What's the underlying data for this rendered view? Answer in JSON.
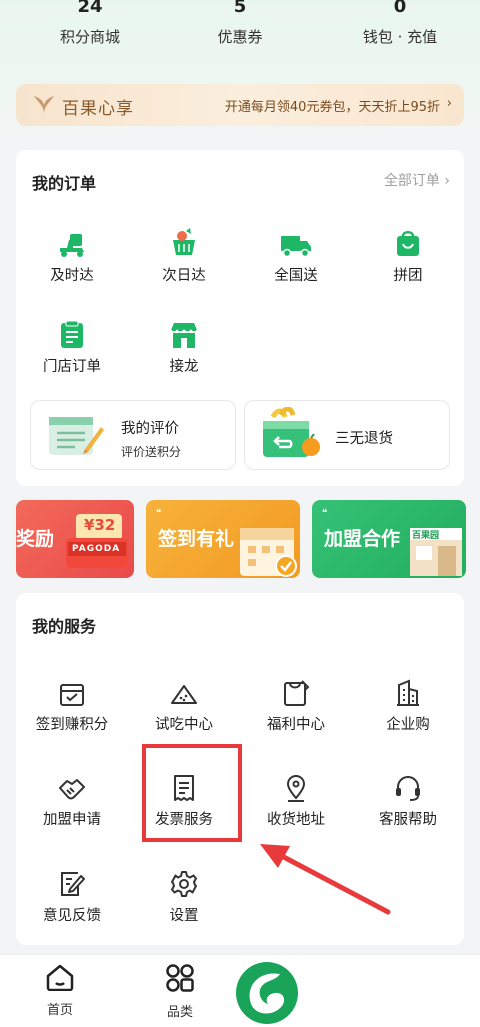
{
  "stats": [
    {
      "value": "24",
      "label": "积分商城"
    },
    {
      "value": "5",
      "label": "优惠券"
    },
    {
      "value": "0",
      "label": "钱包 · 充值"
    }
  ],
  "vip": {
    "brand": "百果心享",
    "promo": "开通每月领40元券包，天天折上95折",
    "chevron": "›"
  },
  "orders": {
    "title": "我的订单",
    "all_label": "全部订单",
    "all_chevron": "›",
    "items": [
      {
        "label": "及时达",
        "icon": "scooter-icon"
      },
      {
        "label": "次日达",
        "icon": "basket-icon"
      },
      {
        "label": "全国送",
        "icon": "truck-icon"
      },
      {
        "label": "拼团",
        "icon": "shopping-bag-icon"
      },
      {
        "label": "门店订单",
        "icon": "store-order-icon"
      },
      {
        "label": "接龙",
        "icon": "storefront-icon"
      }
    ],
    "review": {
      "title": "我的评价",
      "sub": "评价送积分"
    },
    "returns": {
      "title": "三无退货"
    }
  },
  "banners": [
    {
      "label": "奖励",
      "coupon": "¥32",
      "brand": "PAGODA"
    },
    {
      "label": "签到有礼"
    },
    {
      "label": "加盟合作",
      "shop": "百果园"
    }
  ],
  "services": {
    "title": "我的服务",
    "items": [
      {
        "label": "签到赚积分",
        "icon": "calendar-check-icon"
      },
      {
        "label": "试吃中心",
        "icon": "watermelon-icon"
      },
      {
        "label": "福利中心",
        "icon": "gift-card-icon"
      },
      {
        "label": "企业购",
        "icon": "building-icon"
      },
      {
        "label": "加盟申请",
        "icon": "handshake-icon"
      },
      {
        "label": "发票服务",
        "icon": "receipt-icon"
      },
      {
        "label": "收货地址",
        "icon": "location-pin-icon"
      },
      {
        "label": "客服帮助",
        "icon": "headset-icon"
      },
      {
        "label": "意见反馈",
        "icon": "feedback-icon"
      },
      {
        "label": "设置",
        "icon": "gear-icon"
      }
    ]
  },
  "tabbar": [
    {
      "label": "首页",
      "icon": "home-icon"
    },
    {
      "label": "品类",
      "icon": "category-icon"
    }
  ],
  "colors": {
    "brand_green": "#1db766",
    "highlight_red": "#e8393b",
    "vip_text": "#8a5a2c"
  }
}
